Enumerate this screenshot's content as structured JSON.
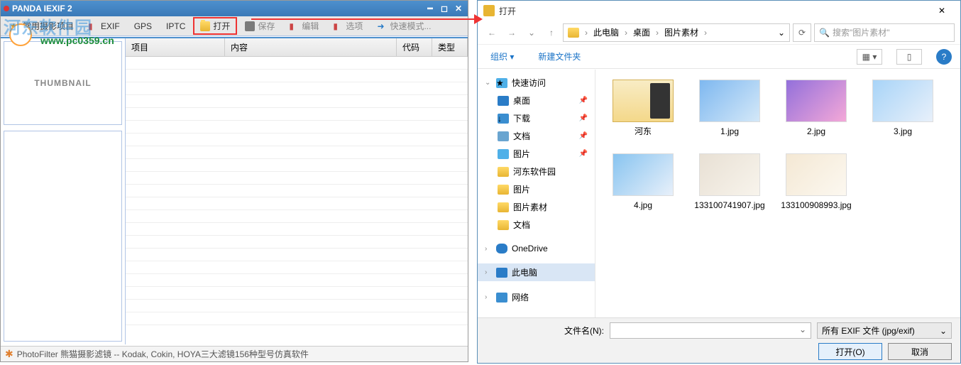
{
  "app": {
    "title": "PANDA IEXIF 2",
    "watermark": "河东软件园",
    "watermark_url": "www.pc0359.cn"
  },
  "toolbar": {
    "common": "常用摄影项目",
    "exif": "EXIF",
    "gps": "GPS",
    "iptc": "IPTC",
    "open": "打开",
    "save": "保存",
    "edit": "编辑",
    "options": "选项",
    "quick": "快速模式..."
  },
  "thumb": "THUMBNAIL",
  "grid": {
    "col1": "项目",
    "col2": "内容",
    "col3": "代码",
    "col4": "类型"
  },
  "status": "PhotoFilter 熊猫摄影滤镜 -- Kodak, Cokin, HOYA三大滤镜156种型号仿真软件",
  "dialog": {
    "title": "打开",
    "breadcrumb": {
      "seg1": "此电脑",
      "seg2": "桌面",
      "seg3": "图片素材"
    },
    "search_placeholder": "搜索\"图片素材\"",
    "organize": "组织",
    "newfolder": "新建文件夹",
    "nav": {
      "quick": "快速访问",
      "desktop": "桌面",
      "downloads": "下载",
      "documents": "文档",
      "pictures": "图片",
      "hedong": "河东软件园",
      "pics2": "图片",
      "picmat": "图片素材",
      "docs2": "文档",
      "onedrive": "OneDrive",
      "thispc": "此电脑",
      "network": "网络"
    },
    "files": {
      "f0": "河东",
      "f1": "1.jpg",
      "f2": "2.jpg",
      "f3": "3.jpg",
      "f4": "4.jpg",
      "f5": "133100741907.jpg",
      "f6": "133100908993.jpg"
    },
    "filename_label": "文件名(N):",
    "filetype": "所有 EXIF 文件 (jpg/exif)",
    "open_btn": "打开(O)",
    "cancel_btn": "取消"
  }
}
